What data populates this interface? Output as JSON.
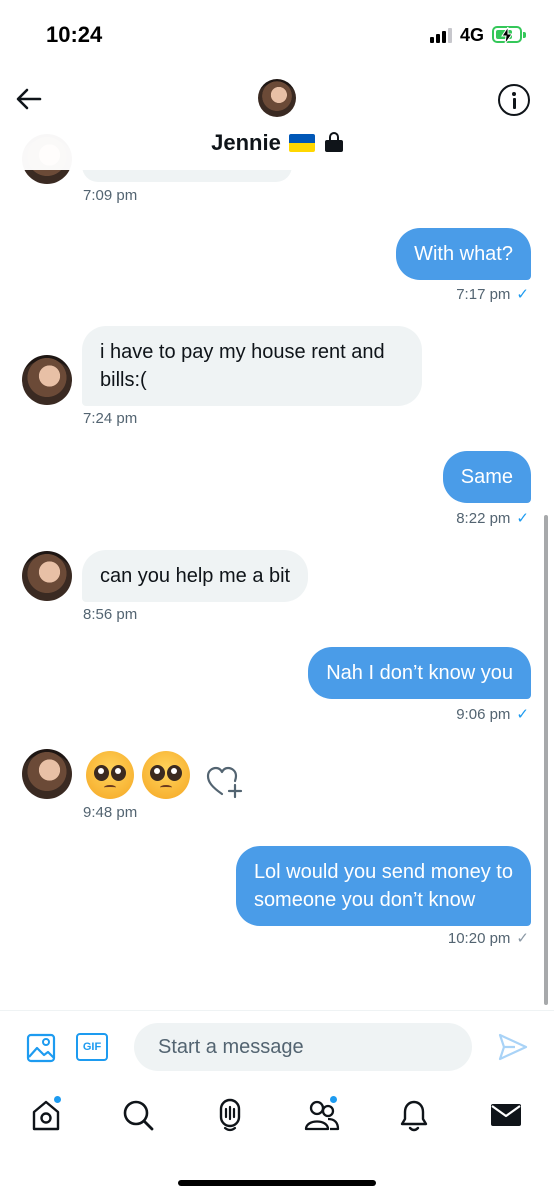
{
  "status_bar": {
    "time": "10:24",
    "network": "4G"
  },
  "header": {
    "name": "Jennie"
  },
  "messages": [
    {
      "direction": "in",
      "time": "7:09 pm"
    },
    {
      "direction": "out",
      "text": "With what?",
      "time": "7:17 pm",
      "status": "✓"
    },
    {
      "direction": "in",
      "lines": [
        "i have to pay my house rent and",
        "bills:("
      ],
      "time": "7:24 pm"
    },
    {
      "direction": "out",
      "text": "Same",
      "time": "8:22 pm",
      "status": "✓"
    },
    {
      "direction": "in",
      "text": "can you help me a bit",
      "time": "8:56 pm"
    },
    {
      "direction": "out",
      "text": "Nah I don’t know you",
      "time": "9:06 pm",
      "status": "✓"
    },
    {
      "direction": "in",
      "emojis": [
        "pleading-face",
        "pleading-face"
      ],
      "time": "9:48 pm"
    },
    {
      "direction": "out",
      "lines": [
        "Lol would you send money to",
        "someone you don’t know"
      ],
      "time": "10:20 pm",
      "status": "✓"
    }
  ],
  "composer": {
    "placeholder": "Start a message",
    "gif_label": "GIF"
  },
  "tabs": [
    "home-icon",
    "search-icon",
    "spaces-icon",
    "communities-icon",
    "notifications-icon",
    "messages-icon"
  ],
  "colors": {
    "accent": "#1d9bf0",
    "bubble_out": "#4a9ce8",
    "bubble_in": "#eff3f4"
  }
}
